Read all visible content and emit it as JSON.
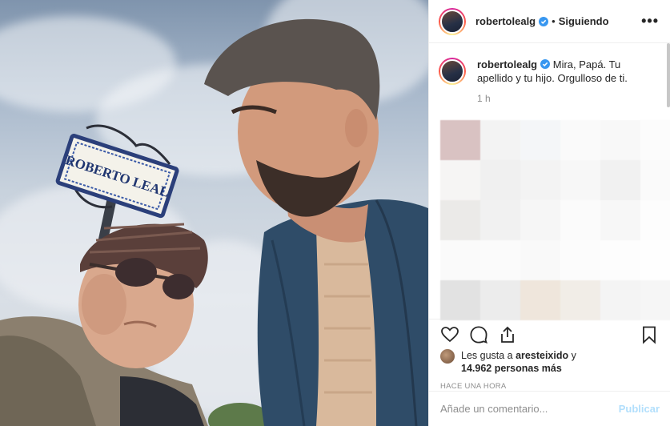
{
  "header": {
    "username": "robertolealg",
    "separator": "•",
    "follow_status": "Siguiendo",
    "more": "•••"
  },
  "caption": {
    "username": "robertolealg",
    "text": "Mira, Papá. Tu apellido y tu hijo. Orgulloso de ti.",
    "time": "1 h"
  },
  "photo": {
    "sign_text": "ROBERTO LEAL"
  },
  "likes": {
    "prefix": "Les gusta a ",
    "user": "aresteixido",
    "middle": " y",
    "count": "14.962 personas más"
  },
  "posted_ago": "HACE UNA HORA",
  "comment_box": {
    "placeholder": "Añade un comentario...",
    "publish": "Publicar"
  },
  "colors": {
    "verified": "#3897f0",
    "publish_disabled": "#b2dffc",
    "meta_gray": "#8e8e8e"
  },
  "icons": [
    "verified-badge-icon",
    "heart-icon",
    "comment-icon",
    "share-icon",
    "bookmark-icon",
    "more-options-icon"
  ],
  "blurred_tiles": [
    "#d9c2c2",
    "#f3f3f3",
    "#f4f6f8",
    "#fafafa",
    "#f8f8f8",
    "#fcfcfc",
    "#f6f5f4",
    "#f0f0f0",
    "#f3f3f3",
    "#f7f7f7",
    "#f1f1f1",
    "#fafafa",
    "#ebeae8",
    "#f1f1f1",
    "#f6f6f6",
    "#fbfbfb",
    "#f7f7f7",
    "#fdfdfd",
    "#fafafa",
    "#fbfbfb",
    "#f9f9f9",
    "#fcfcfc",
    "#fdfdfd",
    "#fefefe",
    "#e2e2e2",
    "#ececec",
    "#efe6dc",
    "#f1ede7",
    "#f4f4f4",
    "#f6f6f6"
  ]
}
